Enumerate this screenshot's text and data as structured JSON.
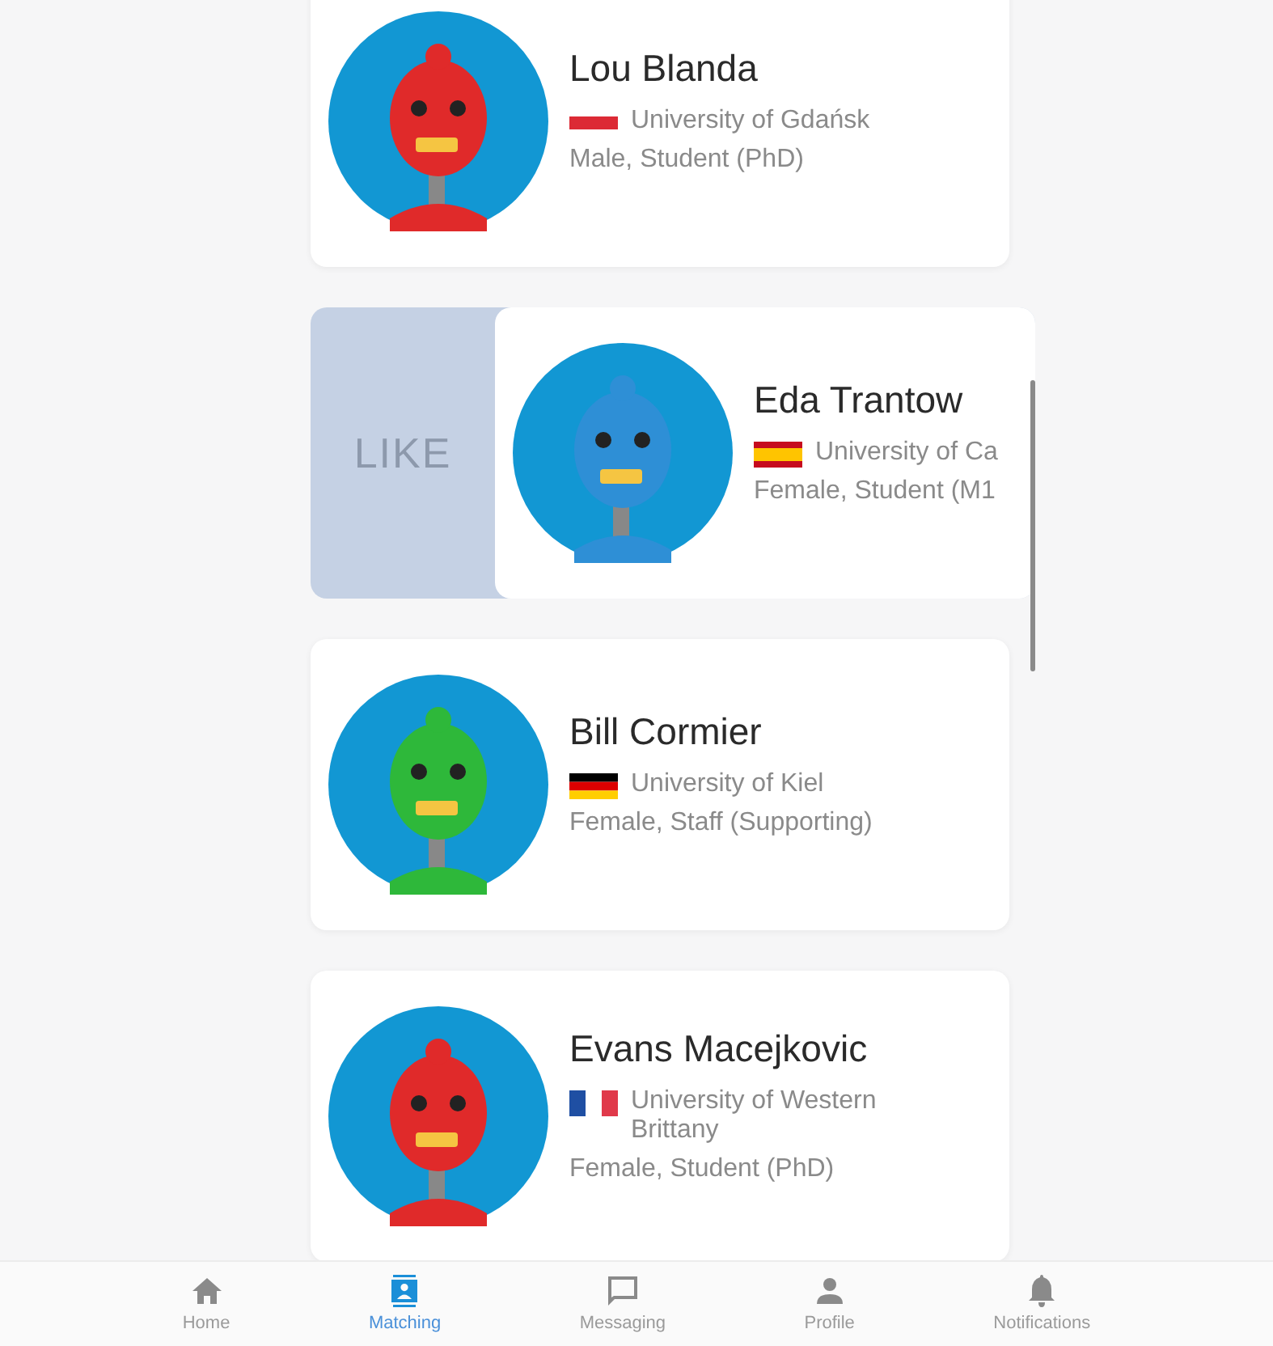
{
  "matches": [
    {
      "name": "Lou Blanda",
      "university": "University of Gdańsk",
      "details": "Male, Student (PhD)",
      "color": "#e02a2a",
      "swiped": false
    },
    {
      "name": "Eda Trantow",
      "university": "University of Ca",
      "details": "Female, Student (M1",
      "color": "#2e8fd6",
      "swiped": true,
      "swipe_label": "LIKE"
    },
    {
      "name": "Bill Cormier",
      "university": "University of Kiel",
      "details": "Female, Staff (Supporting)",
      "color": "#2eb83a",
      "swiped": false
    },
    {
      "name": "Evans Macejkovic",
      "university": "University of Western Brittany",
      "details": "Female, Student (PhD)",
      "color": "#e02a2a",
      "swiped": false
    }
  ],
  "bottom_nav": [
    {
      "label": "Home",
      "selected": false
    },
    {
      "label": "Matching",
      "selected": true
    },
    {
      "label": "Messaging",
      "selected": false
    },
    {
      "label": "Profile",
      "selected": false
    },
    {
      "label": "Notifications",
      "selected": false
    }
  ]
}
